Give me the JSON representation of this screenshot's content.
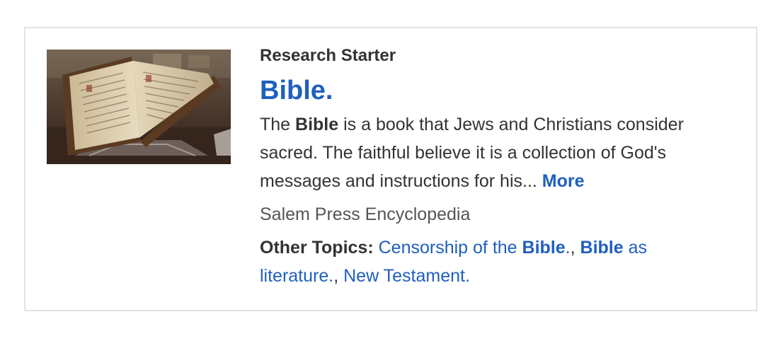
{
  "card": {
    "eyebrow": "Research Starter",
    "title": "Bible.",
    "abstract": {
      "lead": "The ",
      "term": "Bible",
      "rest": " is a book that Jews and Christians consider sacred. The faithful believe it is a collection of God's messages and instructions for his... ",
      "more_label": "More"
    },
    "source": "Salem Press Encyclopedia",
    "topics": {
      "label": "Other Topics:",
      "items": [
        {
          "pre": "Censorship of the ",
          "bold": "Bible",
          "post": "."
        },
        {
          "pre": "",
          "bold": "Bible",
          "post": " as literature."
        },
        {
          "pre": "New Testament.",
          "bold": "",
          "post": ""
        }
      ],
      "separator": ", "
    },
    "thumbnail_icon": "open-book-image"
  },
  "colors": {
    "link": "#1f5fbf",
    "text": "#333333",
    "muted": "#555555",
    "border": "#e3e3e3"
  }
}
